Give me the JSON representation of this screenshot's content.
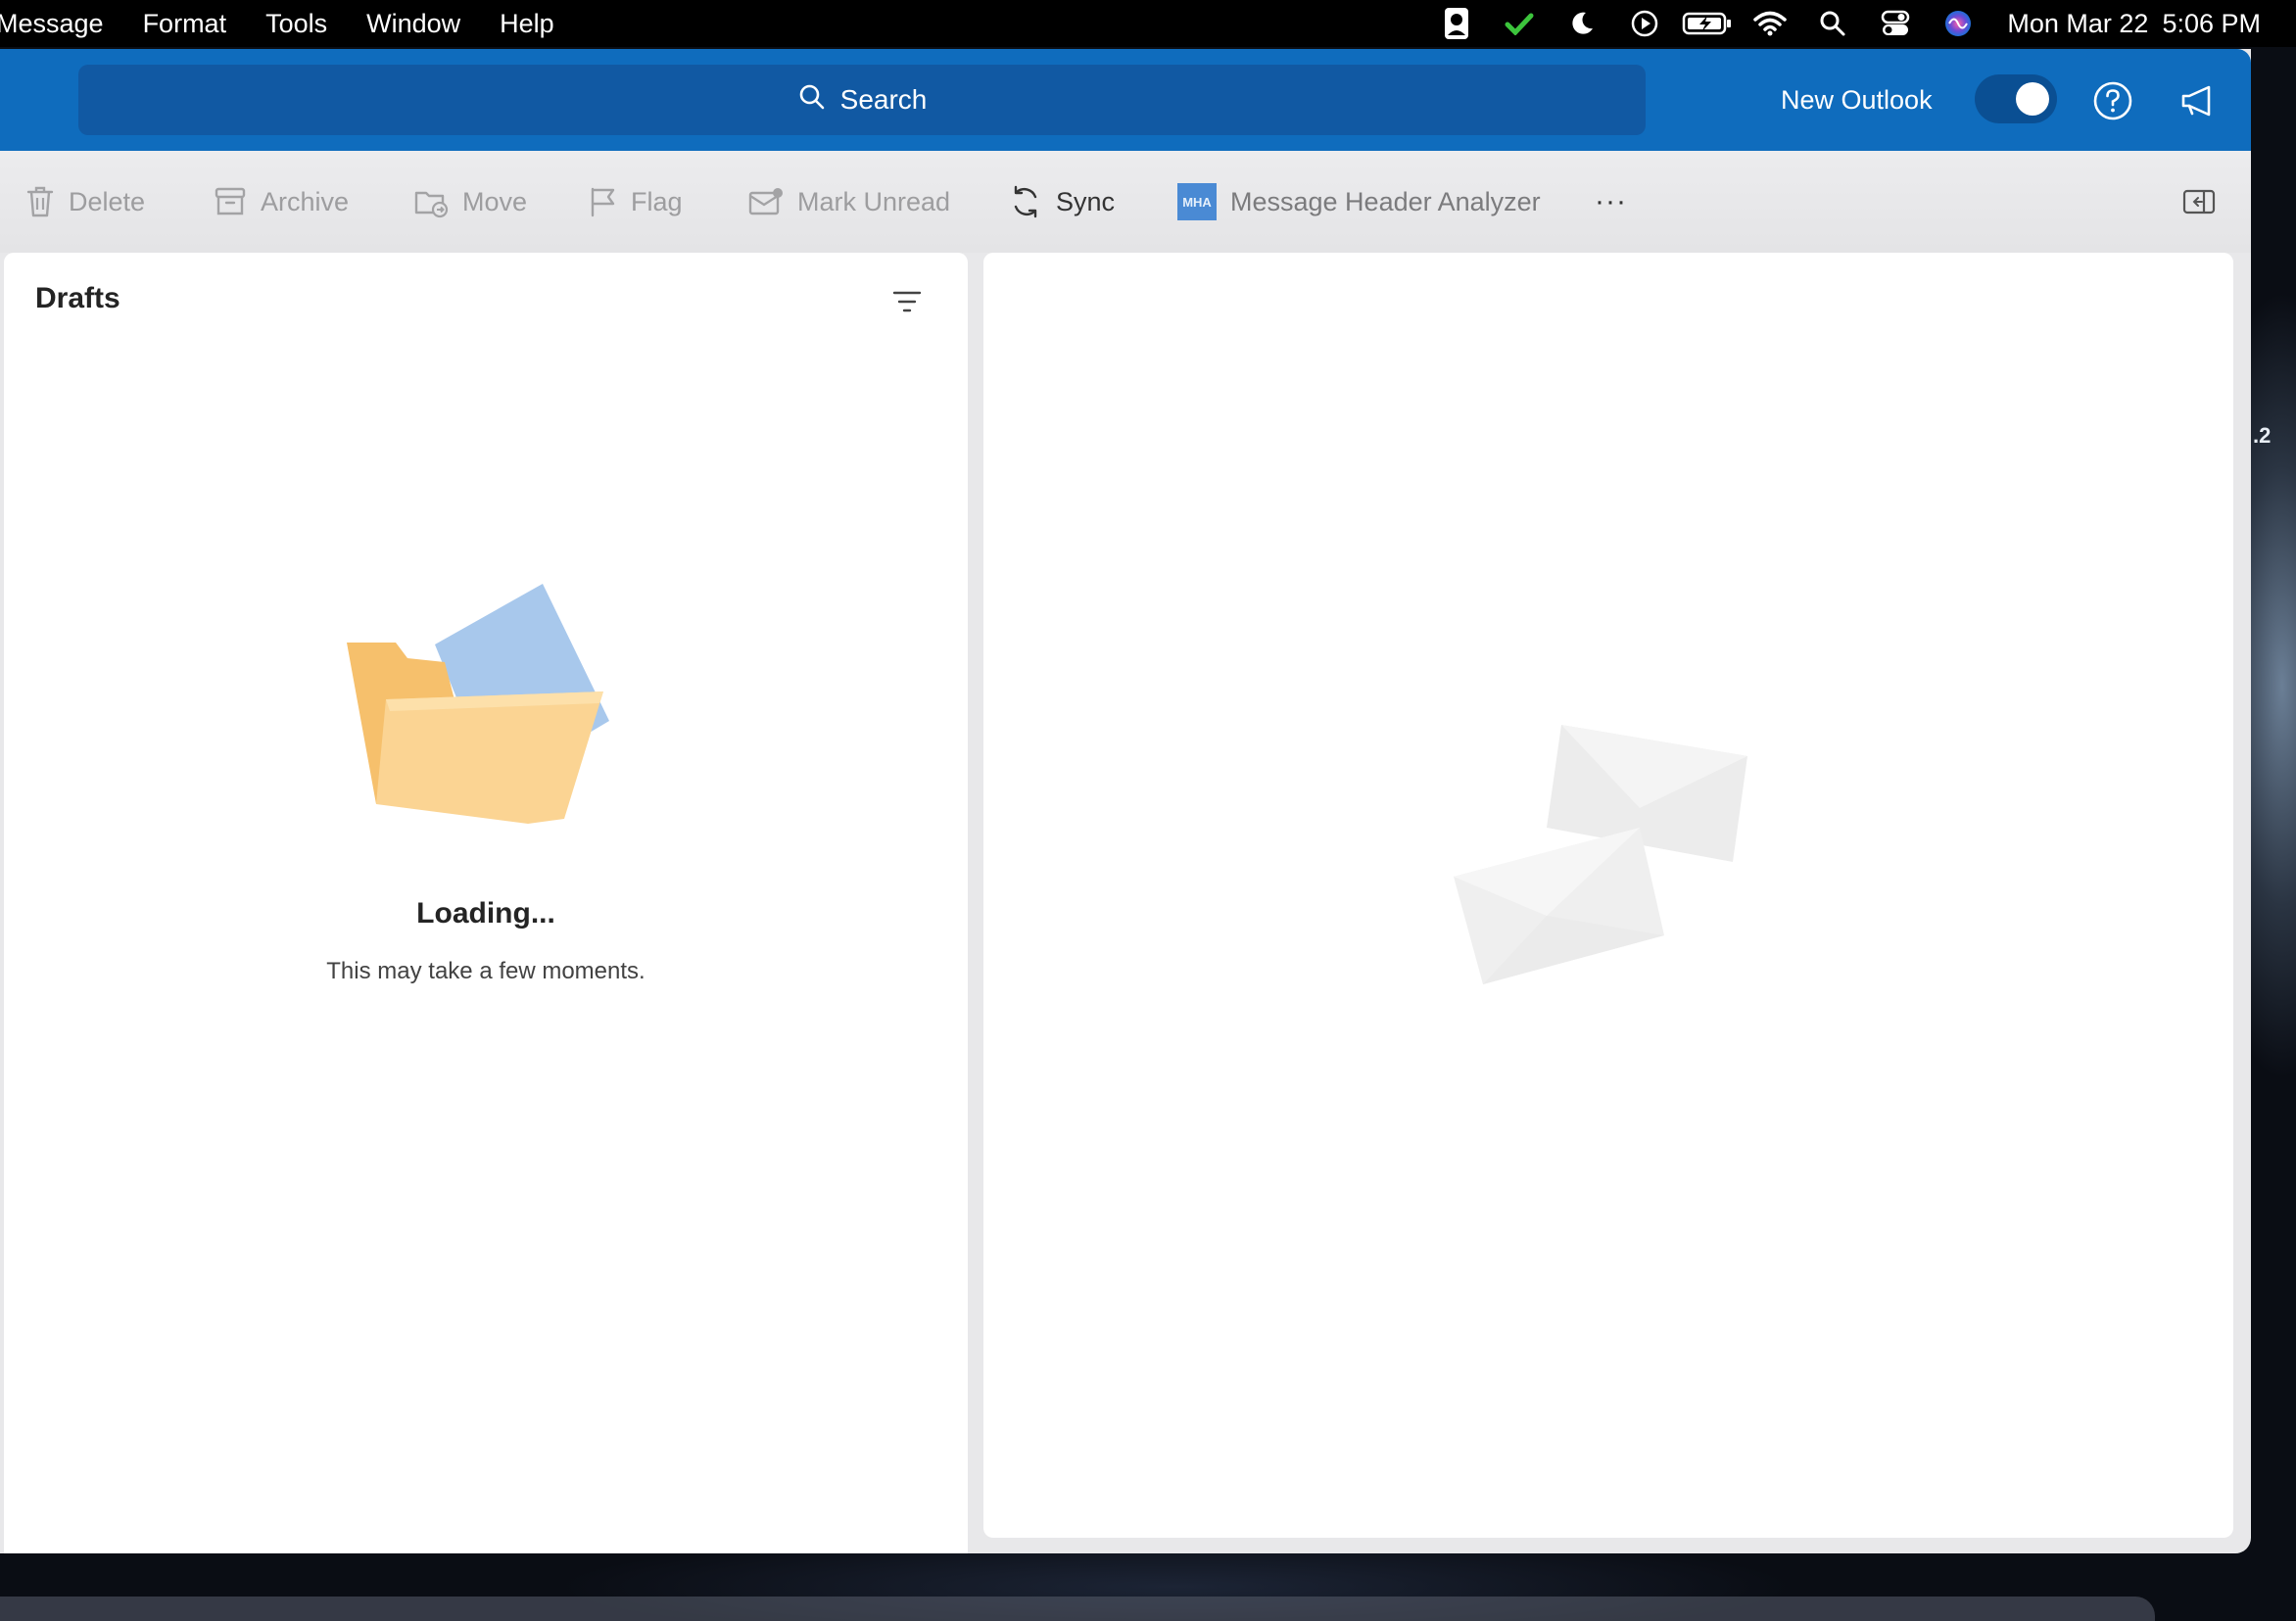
{
  "menubar": {
    "items": [
      "Message",
      "Format",
      "Tools",
      "Window",
      "Help"
    ],
    "status_icons": [
      "privacy-user-icon",
      "checkmark-icon",
      "moon-icon",
      "play-icon",
      "battery-charging-icon",
      "wifi-icon",
      "spotlight-search-icon",
      "control-center-icon",
      "siri-icon"
    ],
    "clock": {
      "date": "Mon Mar 22",
      "time": "5:06 PM"
    }
  },
  "titlebar": {
    "search_label": "Search",
    "new_outlook_label": "New Outlook",
    "new_outlook_toggle_on": true,
    "accent": "#0f6cbd"
  },
  "toolbar": {
    "actions": [
      {
        "label": "Delete",
        "icon": "trash-icon",
        "enabled": false
      },
      {
        "label": "Archive",
        "icon": "archive-icon",
        "enabled": false
      },
      {
        "label": "Move",
        "icon": "move-folder-icon",
        "enabled": false
      },
      {
        "label": "Flag",
        "icon": "flag-icon",
        "enabled": false
      },
      {
        "label": "Mark Unread",
        "icon": "mail-unread-icon",
        "enabled": false
      },
      {
        "label": "Sync",
        "icon": "sync-icon",
        "enabled": true
      },
      {
        "label": "Message Header Analyzer",
        "icon": "mha-addin-icon",
        "badge": "MHA",
        "enabled": true
      }
    ],
    "more_label": "···"
  },
  "message_list": {
    "folder_title": "Drafts",
    "loading_title": "Loading...",
    "loading_subtitle": "This may take a few moments."
  },
  "desktop": {
    "edge_label": ".2"
  }
}
